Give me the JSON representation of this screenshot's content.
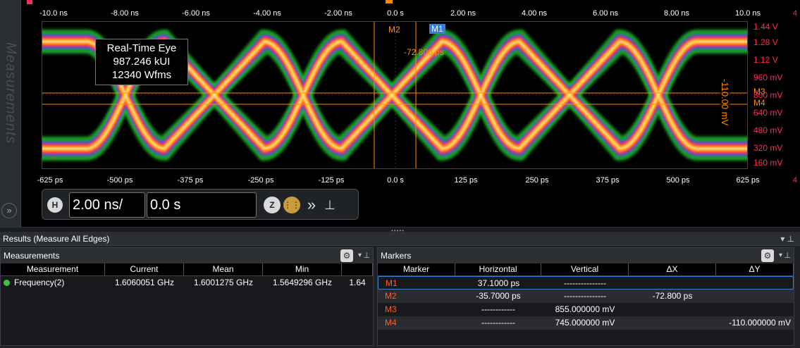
{
  "side_strip": {
    "label": "Measurements"
  },
  "top_axis": {
    "ticks": [
      "-10.0 ns",
      "-8.00 ns",
      "-6.00 ns",
      "-4.00 ns",
      "-2.00 ns",
      "0.0 s",
      "2.00 ns",
      "4.00 ns",
      "6.00 ns",
      "8.00 ns",
      "10.0 ns"
    ],
    "edge": "4"
  },
  "bottom_axis": {
    "ticks": [
      "-625 ps",
      "-500 ps",
      "-375 ps",
      "-250 ps",
      "-125 ps",
      "0.0 s",
      "125 ps",
      "250 ps",
      "375 ps",
      "500 ps",
      "625 ps"
    ],
    "edge": "4"
  },
  "vertical_scale": [
    "1.44 V",
    "1.28 V",
    "1.12 V",
    "960 mV",
    "800 mV",
    "640 mV",
    "480 mV",
    "320 mV",
    "160 mV"
  ],
  "eye_label": {
    "line1": "Real-Time Eye",
    "line2": "987.246 kUI",
    "line3": "12340 Wfms"
  },
  "markers_overlay": {
    "m1": "M1",
    "m2": "M2",
    "m3": "M3",
    "m4": "M4",
    "dx": "-72.800 ps",
    "dy": "-110.00 mV"
  },
  "horizontal_control": {
    "h_label": "H",
    "scale": "2.00 ns/",
    "position": "0.0 s",
    "zoom_label": "Z"
  },
  "results": {
    "title": "Results  (Measure All Edges)",
    "measurements": {
      "title": "Measurements",
      "columns": [
        "Measurement",
        "Current",
        "Mean",
        "Min",
        ""
      ],
      "rows": [
        {
          "name": "Frequency(2)",
          "current": "1.6060051 GHz",
          "mean": "1.6001275 GHz",
          "min": "1.5649296 GHz",
          "extra": "1.64"
        }
      ]
    },
    "markers": {
      "title": "Markers",
      "columns": [
        "Marker",
        "Horizontal",
        "Vertical",
        "ΔX",
        "ΔY"
      ],
      "rows": [
        {
          "marker": "M1",
          "horizontal": "37.1000 ps",
          "vertical": "---------------",
          "dx": "",
          "dy": ""
        },
        {
          "marker": "M2",
          "horizontal": "-35.7000 ps",
          "vertical": "---------------",
          "dx": "-72.800 ps",
          "dy": ""
        },
        {
          "marker": "M3",
          "horizontal": "------------",
          "vertical": "855.000000 mV",
          "dx": "",
          "dy": ""
        },
        {
          "marker": "M4",
          "horizontal": "------------",
          "vertical": "745.000000 mV",
          "dx": "",
          "dy": "-110.000000 mV"
        }
      ]
    }
  },
  "colors": {
    "accent": "#3a7bd5",
    "marker": "#ff8c00",
    "scale": "#ff2d55",
    "status_ok": "#3cc43c"
  }
}
